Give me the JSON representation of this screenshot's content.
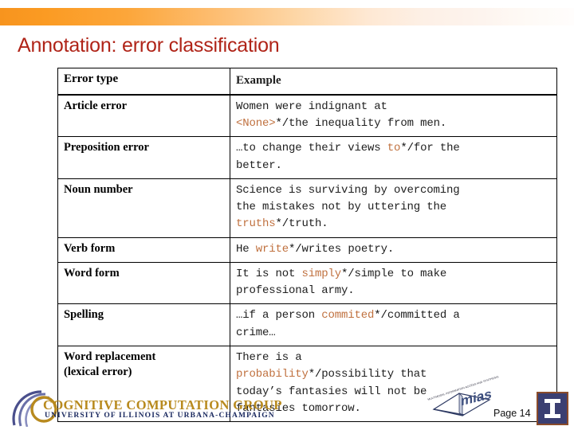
{
  "slide": {
    "title": "Annotation: error classification",
    "page_label": "Page 14",
    "accent_colors": {
      "title_red": "#B02418",
      "bar_orange": "#F7941E",
      "error_token": "#C0713F",
      "correction_token": "#3A49B8",
      "logo_gold": "#B88A1E",
      "logo_navy": "#1B2A60",
      "illinois_navy": "#3B3F72",
      "illinois_border": "#8A4B2A"
    }
  },
  "table": {
    "headers": {
      "type": "Error type",
      "example": "Example"
    },
    "rows": [
      {
        "type": "Article error",
        "type_line2": "",
        "example_plain": "Women were indignant at <None>*/the inequality from men.",
        "lines": [
          [
            {
              "t": "Women were indignant at",
              "c": "plain"
            }
          ],
          [
            {
              "t": "<None>",
              "c": "err"
            },
            {
              "t": "*/",
              "c": "sep"
            },
            {
              "t": "the",
              "c": "corr"
            },
            {
              "t": " inequality from men.",
              "c": "plain"
            }
          ]
        ]
      },
      {
        "type": "Preposition error",
        "type_line2": "",
        "example_plain": "…to change their views to*/for the better.",
        "lines": [
          [
            {
              "t": "…to change their views ",
              "c": "plain"
            },
            {
              "t": "to",
              "c": "err"
            },
            {
              "t": "*/",
              "c": "sep"
            },
            {
              "t": "for",
              "c": "corr"
            },
            {
              "t": " the",
              "c": "plain"
            }
          ],
          [
            {
              "t": "better.",
              "c": "plain"
            }
          ]
        ]
      },
      {
        "type": "Noun number",
        "type_line2": "",
        "example_plain": "Science is surviving by overcoming the mistakes not by uttering the truths*/truth.",
        "lines": [
          [
            {
              "t": "Science is surviving by overcoming",
              "c": "plain"
            }
          ],
          [
            {
              "t": "the mistakes not by uttering the",
              "c": "plain"
            }
          ],
          [
            {
              "t": "truths",
              "c": "err"
            },
            {
              "t": "*/",
              "c": "sep"
            },
            {
              "t": "truth",
              "c": "corr"
            },
            {
              "t": ".",
              "c": "plain"
            }
          ]
        ]
      },
      {
        "type": "Verb form",
        "type_line2": "",
        "example_plain": "He write*/writes poetry.",
        "lines": [
          [
            {
              "t": "He ",
              "c": "plain"
            },
            {
              "t": "write",
              "c": "err"
            },
            {
              "t": "*/",
              "c": "sep"
            },
            {
              "t": "writes",
              "c": "corr"
            },
            {
              "t": " poetry.",
              "c": "plain"
            }
          ]
        ]
      },
      {
        "type": "Word form",
        "type_line2": "",
        "example_plain": "It is not simply*/simple to make professional army.",
        "lines": [
          [
            {
              "t": "It is not ",
              "c": "plain"
            },
            {
              "t": "simply",
              "c": "err"
            },
            {
              "t": "*/",
              "c": "sep"
            },
            {
              "t": "simple",
              "c": "corr"
            },
            {
              "t": " to make",
              "c": "plain"
            }
          ],
          [
            {
              "t": "professional army.",
              "c": "plain"
            }
          ]
        ]
      },
      {
        "type": "Spelling",
        "type_line2": "",
        "example_plain": "…if a person commited*/committed a crime…",
        "lines": [
          [
            {
              "t": "…if a person ",
              "c": "plain"
            },
            {
              "t": "commited",
              "c": "err"
            },
            {
              "t": "*/",
              "c": "sep"
            },
            {
              "t": "committed",
              "c": "corr"
            },
            {
              "t": " a",
              "c": "plain"
            }
          ],
          [
            {
              "t": "crime…",
              "c": "plain"
            }
          ]
        ]
      },
      {
        "type": "Word replacement",
        "type_line2": "(lexical error)",
        "example_plain": "There is a probability*/possibility that today's fantasies will not be fantasies tomorrow.",
        "lines": [
          [
            {
              "t": "There is a",
              "c": "plain"
            }
          ],
          [
            {
              "t": "probability",
              "c": "err"
            },
            {
              "t": "*/",
              "c": "sep"
            },
            {
              "t": "possibility",
              "c": "corr"
            },
            {
              "t": " that",
              "c": "plain"
            }
          ],
          [
            {
              "t": "today’s fantasies will not be",
              "c": "plain"
            }
          ],
          [
            {
              "t": "fantasies tomorrow.",
              "c": "plain"
            }
          ]
        ]
      }
    ]
  },
  "footer": {
    "ccg_logo": {
      "line1": "COGNITIVE COMPUTATION GROUP",
      "line2": "UNIVERSITY OF ILLINOIS AT URBANA-CHAMPAIGN"
    },
    "mias_logo": {
      "wordmark": "mias",
      "tiny_text": "MULTIMODAL INFORMATION ACCESS AND SYNTHESIS"
    },
    "illinois_logo": {
      "name": "Illinois block I"
    }
  }
}
